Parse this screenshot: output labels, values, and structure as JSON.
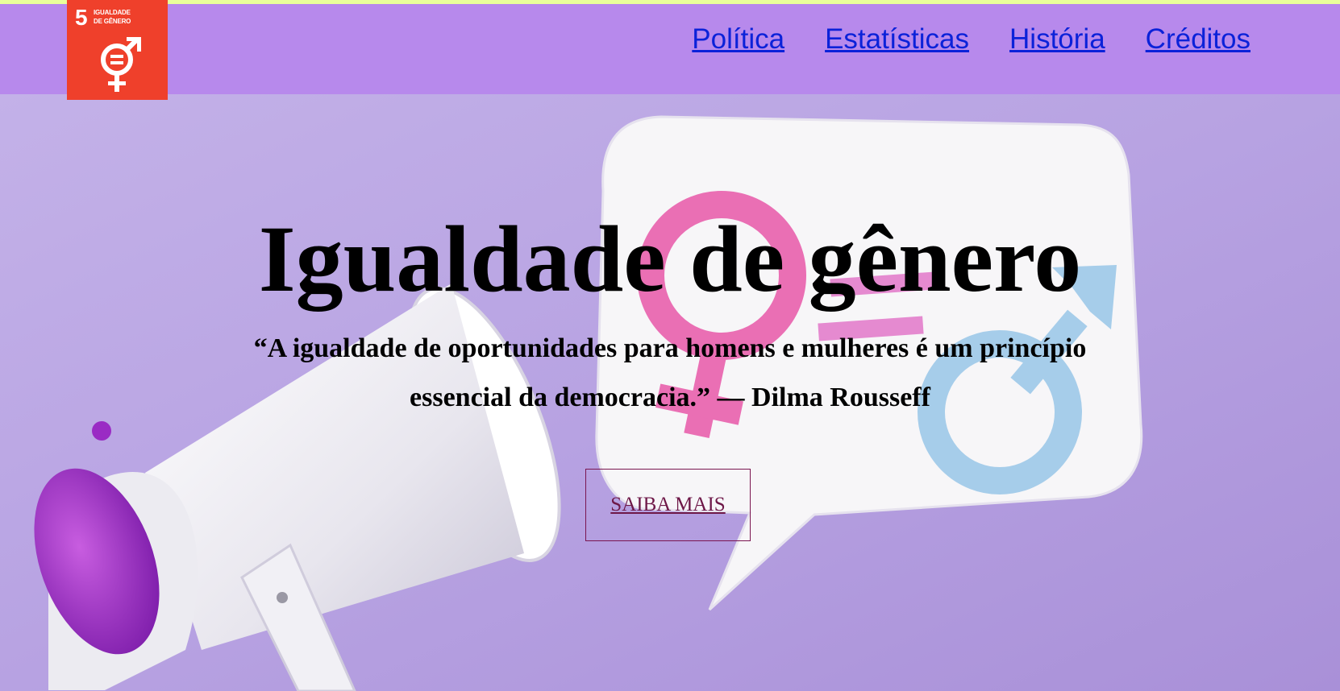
{
  "logo": {
    "number": "5",
    "line1": "IGUALDADE",
    "line2": "DE GÊNERO",
    "icon": "gender-equality-icon",
    "color": "#ef402b"
  },
  "nav": {
    "items": [
      {
        "label": "Política"
      },
      {
        "label": "Estatísticas"
      },
      {
        "label": "História"
      },
      {
        "label": "Créditos"
      }
    ],
    "link_color": "#0b22d9",
    "background": "#b789ec"
  },
  "hero": {
    "title": "Igualdade de gênero",
    "quote": "“A igualdade de oportunidades para homens e mulheres é um princípio essencial da democracia.” — Dilma Rousseff",
    "button_label": "SAIBA MAIS",
    "background": "#b9a6e2"
  }
}
